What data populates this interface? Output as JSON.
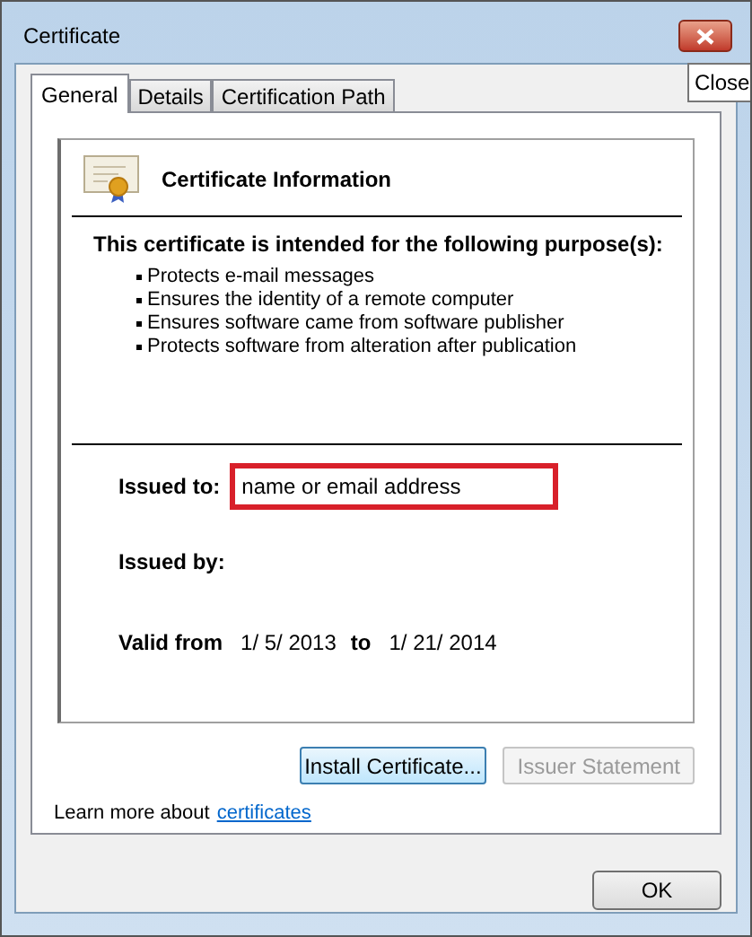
{
  "window": {
    "title": "Certificate",
    "close_tooltip": "Close"
  },
  "tabs": [
    {
      "label": "General",
      "selected": true
    },
    {
      "label": "Details",
      "selected": false
    },
    {
      "label": "Certification Path",
      "selected": false
    }
  ],
  "info": {
    "heading": "Certificate Information",
    "purpose_heading": "This certificate is intended for the following purpose(s):",
    "purposes": [
      "Protects e-mail messages",
      "Ensures the identity of a remote computer",
      "Ensures software came from software publisher",
      "Protects software from alteration after publication"
    ],
    "issued_to_label": "Issued to:",
    "issued_to_value": "name or email address",
    "issued_by_label": "Issued by:",
    "valid_from_label": "Valid from",
    "valid_from": "1/ 5/ 2013",
    "valid_to_label": "to",
    "valid_to": "1/ 21/ 2014"
  },
  "buttons": [
    {
      "label": "Install Certificate...",
      "disabled": false
    },
    {
      "label": "Issuer Statement",
      "disabled": true
    }
  ],
  "learn_more": {
    "text": "Learn more about",
    "link": "certificates"
  },
  "ok_button": "OK"
}
